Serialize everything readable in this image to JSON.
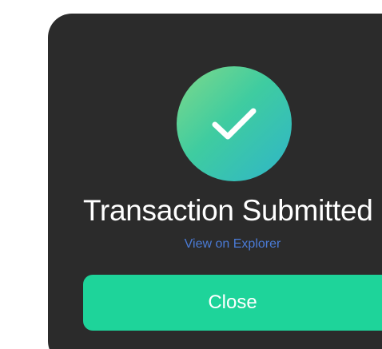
{
  "modal": {
    "title": "Transaction Submitted",
    "explorer_link": "View on Explorer",
    "close_label": "Close",
    "status_icon": "checkmark-icon"
  },
  "colors": {
    "modal_background": "#2b2b2b",
    "page_background": "#ffffff",
    "title_text": "#ffffff",
    "link": "#4a7bd6",
    "button": "#1ed49a",
    "badge_gradient": [
      "#7fd98a",
      "#3fcca0",
      "#2fb5c9"
    ]
  }
}
